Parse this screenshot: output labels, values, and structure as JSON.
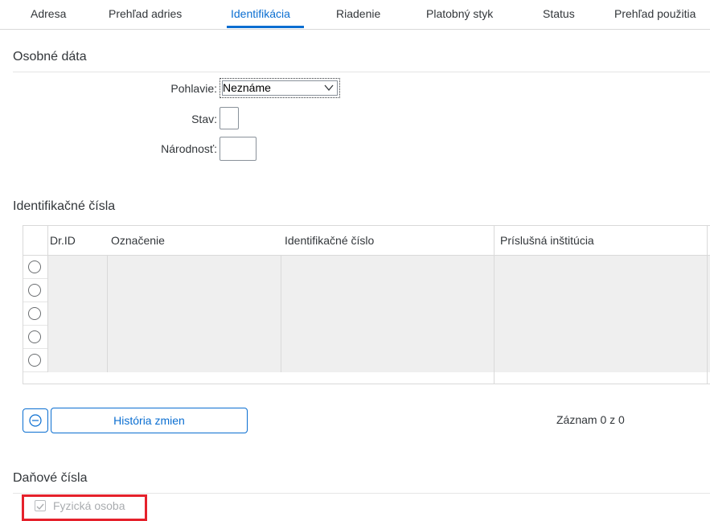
{
  "tabs": [
    {
      "label": "Adresa"
    },
    {
      "label": "Prehľad adries"
    },
    {
      "label": "Identifikácia"
    },
    {
      "label": "Riadenie"
    },
    {
      "label": "Platobný styk"
    },
    {
      "label": "Status"
    },
    {
      "label": "Prehľad použitia"
    }
  ],
  "active_tab": "Identifikácia",
  "personal": {
    "title": "Osobné dáta",
    "gender_label": "Pohlavie:",
    "gender_value": "Neznáme",
    "status_label": "Stav:",
    "status_value": "",
    "nationality_label": "Národnosť:",
    "nationality_value": ""
  },
  "id_numbers": {
    "title": "Identifikačné čísla",
    "columns": [
      "Dr.ID",
      "Označenie",
      "Identifikačné číslo",
      "Príslušná inštitúcia"
    ],
    "rows": [
      {
        "dr_id": "",
        "designation": "",
        "number": "",
        "institution": ""
      },
      {
        "dr_id": "",
        "designation": "",
        "number": "",
        "institution": ""
      },
      {
        "dr_id": "",
        "designation": "",
        "number": "",
        "institution": ""
      },
      {
        "dr_id": "",
        "designation": "",
        "number": "",
        "institution": ""
      },
      {
        "dr_id": "",
        "designation": "",
        "number": "",
        "institution": ""
      }
    ],
    "history_button": "História zmien",
    "record_text": "Záznam 0 z 0"
  },
  "tax": {
    "title": "Daňové čísla",
    "natural_person_label": "Fyzická osoba",
    "natural_person_checked": true
  },
  "colors": {
    "accent": "#0a6ed1",
    "highlight": "#e5212b"
  }
}
